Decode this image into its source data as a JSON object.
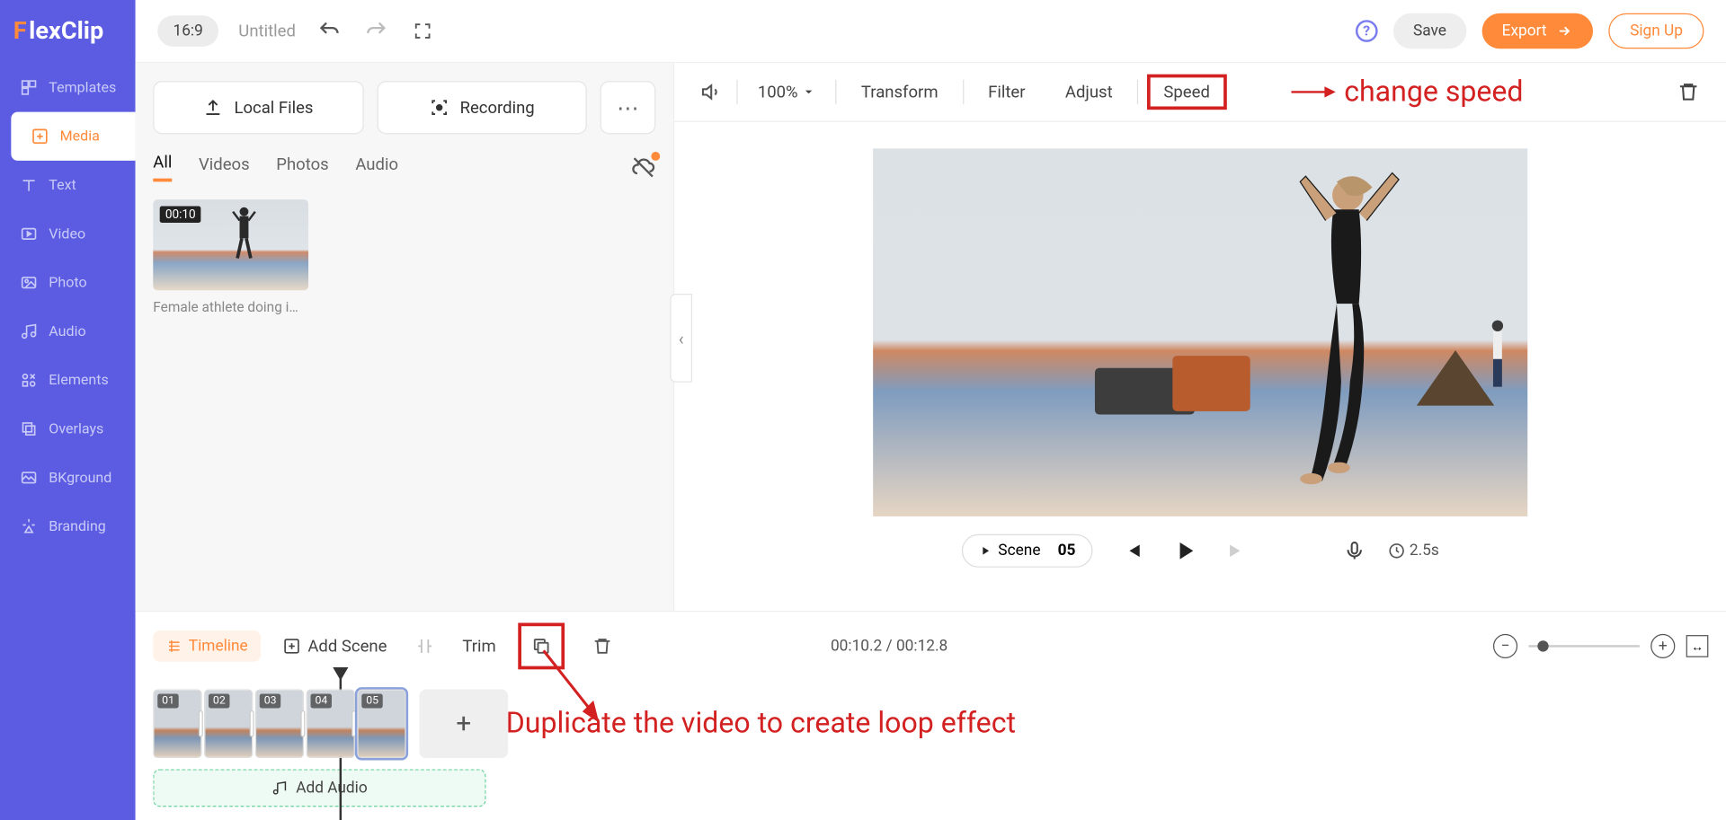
{
  "brand": "FlexClip",
  "sidebar": {
    "items": [
      {
        "label": "Templates"
      },
      {
        "label": "Media"
      },
      {
        "label": "Text"
      },
      {
        "label": "Video"
      },
      {
        "label": "Photo"
      },
      {
        "label": "Audio"
      },
      {
        "label": "Elements"
      },
      {
        "label": "Overlays"
      },
      {
        "label": "BKground"
      },
      {
        "label": "Branding"
      }
    ]
  },
  "topbar": {
    "aspect": "16:9",
    "title": "Untitled",
    "save": "Save",
    "export": "Export",
    "signup": "Sign Up"
  },
  "media": {
    "local_files": "Local Files",
    "recording": "Recording",
    "tabs": [
      "All",
      "Videos",
      "Photos",
      "Audio"
    ],
    "thumb_duration": "00:10",
    "thumb_label": "Female athlete doing im…"
  },
  "preview_toolbar": {
    "zoom": "100%",
    "transform": "Transform",
    "filter": "Filter",
    "adjust": "Adjust",
    "speed": "Speed"
  },
  "annotations": {
    "change_speed": "change speed",
    "duplicate": "Duplicate the video to create loop effect"
  },
  "player": {
    "scene_label": "Scene",
    "scene_num": "05",
    "duration": "2.5s"
  },
  "timeline": {
    "timeline_label": "Timeline",
    "add_scene": "Add Scene",
    "trim": "Trim",
    "timecode": "00:10.2 / 00:12.8",
    "scenes": [
      "01",
      "02",
      "03",
      "04",
      "05"
    ],
    "add_audio": "Add Audio"
  }
}
